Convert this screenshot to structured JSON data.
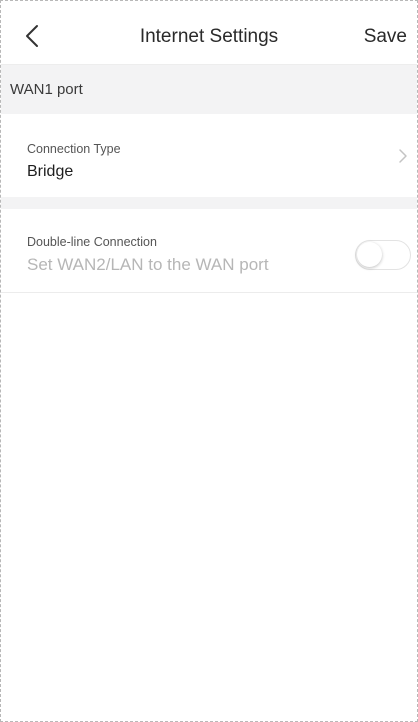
{
  "navbar": {
    "back_icon": "chevron-left-icon",
    "title": "Internet Settings",
    "save_label": "Save"
  },
  "section": {
    "header": "WAN1 port"
  },
  "connection_type": {
    "label": "Connection Type",
    "value": "Bridge",
    "chevron_icon": "chevron-right-icon"
  },
  "double_line": {
    "label": "Double-line Connection",
    "description": "Set WAN2/LAN to the WAN port",
    "toggle_on": false
  },
  "colors": {
    "background": "#ffffff",
    "section_bg": "#f3f3f4",
    "muted_text": "#b6b6b6"
  }
}
